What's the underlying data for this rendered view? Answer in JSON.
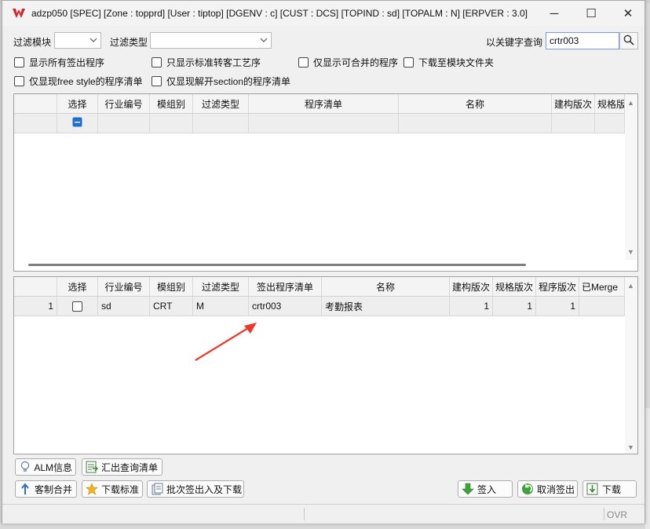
{
  "window": {
    "title": "adzp050 [SPEC]  [Zone : topprd]  [User : tiptop]  [DGENV : c]  [CUST : DCS]  [TOPIND : sd]  [TOPALM : N]  [ERPVER : 3.0]",
    "controls": {
      "minimize": "─",
      "maximize": "☐",
      "close": "✕"
    }
  },
  "filters": {
    "module_label": "过滤模块",
    "module_value": "",
    "type_label": "过滤类型",
    "type_value": "",
    "keyword_label": "以关键字查询",
    "keyword_value": "crtr003"
  },
  "checkboxes": [
    "显示所有签出程序",
    "只显示标准转客工艺序",
    "仅显示可合并的程序",
    "下载至模块文件夹",
    "仅显现free style的程序清单",
    "仅显现解开section的程序清单"
  ],
  "top_grid": {
    "columns": [
      "选择",
      "行业编号",
      "模组别",
      "过滤类型",
      "程序清单",
      "名称",
      "建构版次",
      "规格版"
    ]
  },
  "bottom_grid": {
    "columns": [
      "选择",
      "行业编号",
      "模组别",
      "过滤类型",
      "签出程序清单",
      "名称",
      "建构版次",
      "规格版次",
      "程序版次",
      "已Merge"
    ],
    "rows": [
      {
        "no": "1",
        "industry": "sd",
        "module": "CRT",
        "type": "M",
        "program": "crtr003",
        "name": "考勤报表",
        "build_ver": "1",
        "spec_ver": "1",
        "prog_ver": "1",
        "merged": ""
      }
    ]
  },
  "buttons": {
    "alm_info": "ALM信息",
    "export_list": "汇出查询清单",
    "custom_merge": "客制合并",
    "download_std": "下载标准",
    "batch_checkout": "批次签出入及下载",
    "checkin": "签入",
    "cancel_checkout": "取消签出",
    "download": "下载"
  },
  "status": {
    "mode": "OVR"
  }
}
